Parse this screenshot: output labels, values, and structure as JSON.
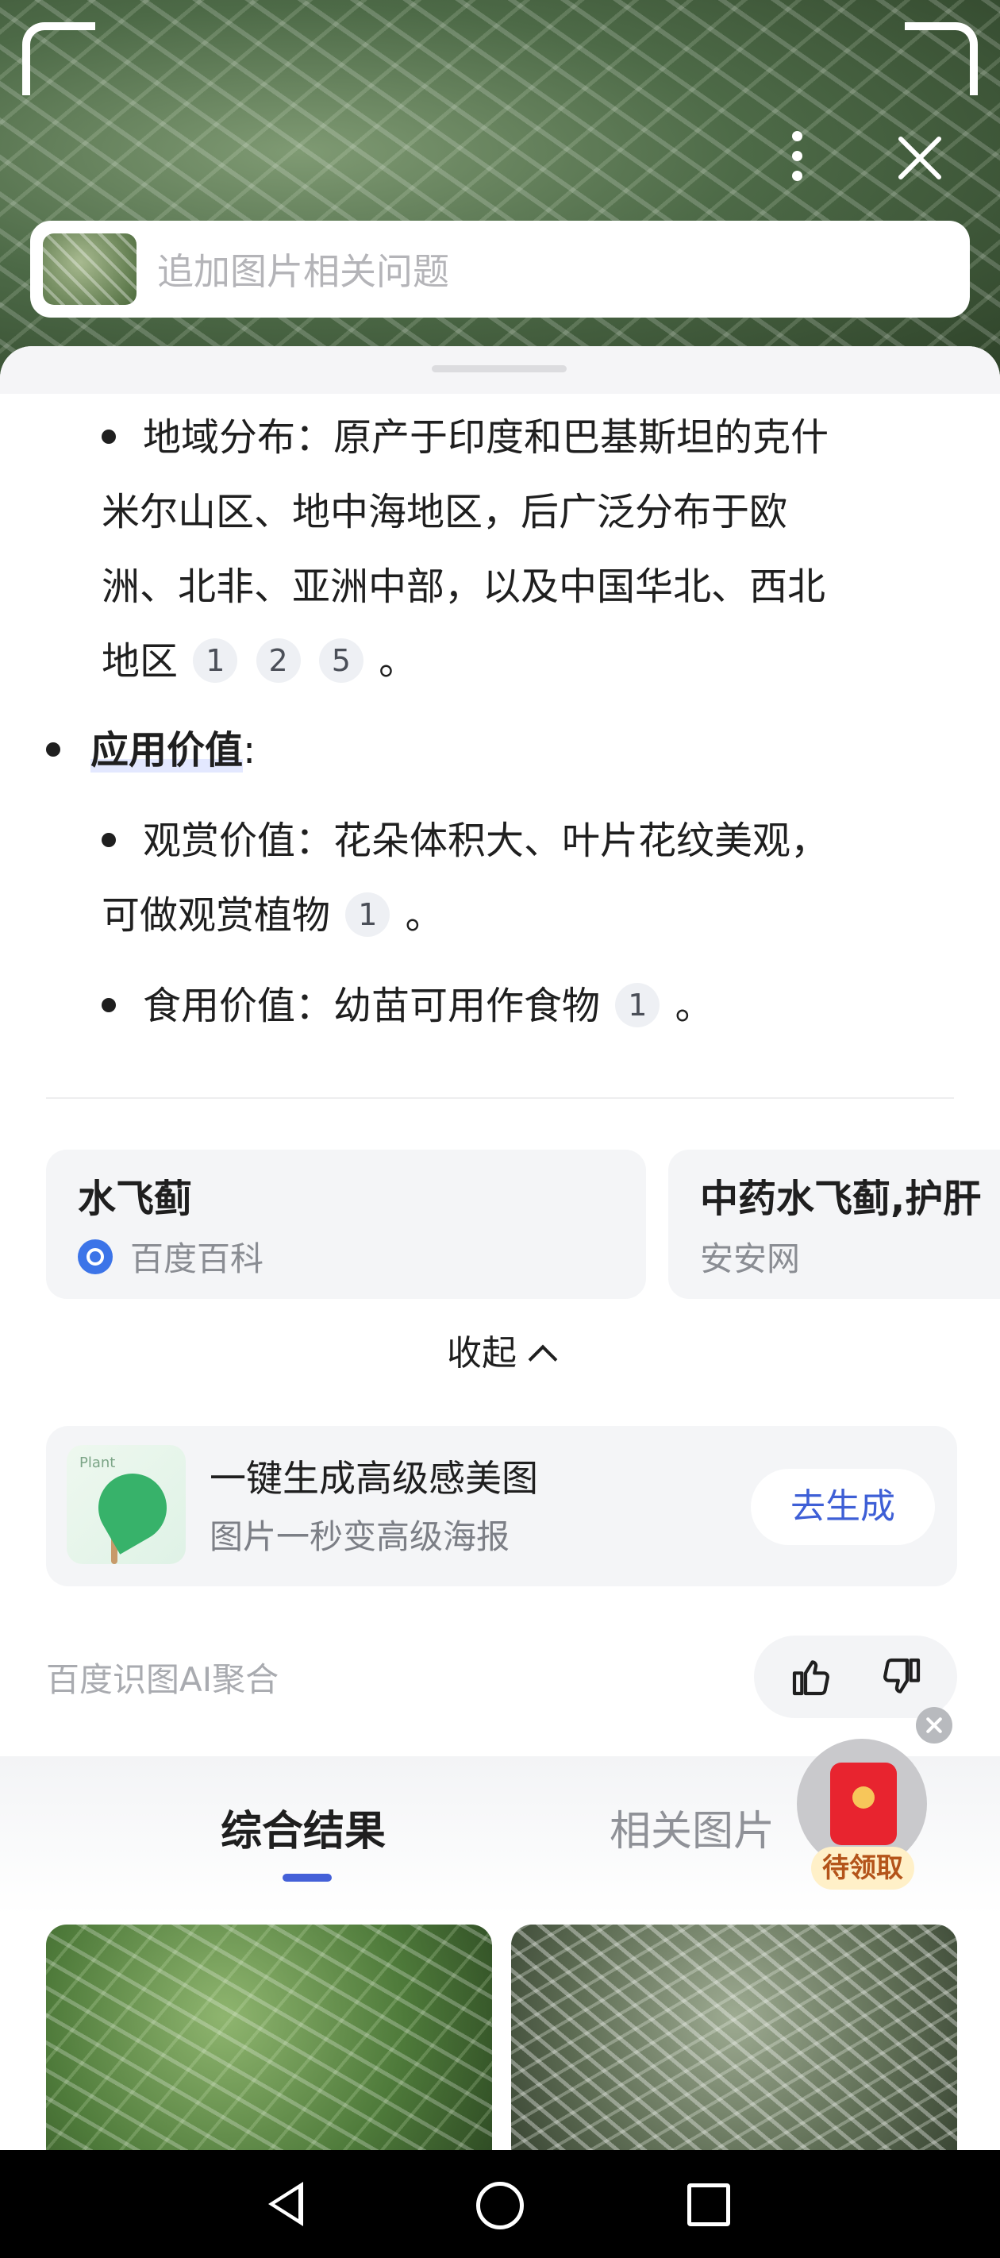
{
  "search": {
    "placeholder": "追加图片相关问题"
  },
  "answer": {
    "distribution": {
      "line1": "地域分布：原产于印度和巴基斯坦的克什",
      "line2": "米尔山区、地中海地区，后广泛分布于欧",
      "line3": "洲、北非、亚洲中部，以及中国华北、西北",
      "line4": "地区",
      "cites": [
        "1",
        "2",
        "5"
      ],
      "end": "。"
    },
    "value_heading": "应用价值",
    "value_colon": ":",
    "ornamental": {
      "line1": "观赏价值：花朵体积大、叶片花纹美观，",
      "line2": "可做观赏植物",
      "cite": "1",
      "end": "。"
    },
    "edible": {
      "text": "食用价值：幼苗可用作食物",
      "cite": "1",
      "end": "。"
    }
  },
  "sources": [
    {
      "title": "水飞蓟",
      "site": "百度百科",
      "icon": "baike-icon"
    },
    {
      "title": "中药水飞蓟,护肝",
      "site": "安安网"
    }
  ],
  "collapse_label": "收起",
  "generate": {
    "thumb_label": "Plant",
    "title": "一键生成高级感美图",
    "subtitle": "图片一秒变高级海报",
    "button": "去生成"
  },
  "ai_label": "百度识图AI聚合",
  "tabs": [
    "综合结果",
    "相关图片"
  ],
  "red_packet": {
    "label": "待领取"
  },
  "colors": {
    "accent": "#4460d8",
    "packet_red": "#e8242f"
  }
}
